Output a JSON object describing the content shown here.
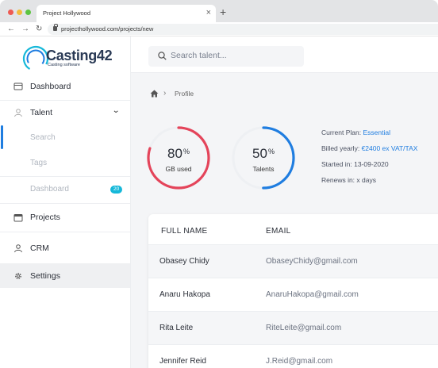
{
  "browser": {
    "tab_title": "Project Hollywood",
    "url": "projecthollywood.com/projects/new"
  },
  "sidebar": {
    "logo_text": "Casting42",
    "logo_sub": "Casting software",
    "items": [
      {
        "label": "Dashboard"
      },
      {
        "label": "Talent"
      },
      {
        "label": "Search"
      },
      {
        "label": "Tags"
      },
      {
        "label": "Dashboard",
        "badge": "20"
      },
      {
        "label": "Projects"
      },
      {
        "label": "CRM"
      },
      {
        "label": "Settings"
      }
    ]
  },
  "search": {
    "placeholder": "Search talent..."
  },
  "breadcrumb": {
    "current": "Profile"
  },
  "gauges": [
    {
      "value": "80",
      "unit": "%",
      "label": "GB used",
      "fraction": 0.8,
      "color": "#e4445a"
    },
    {
      "value": "50",
      "unit": "%",
      "label": "Talents",
      "fraction": 0.5,
      "color": "#1f7de0"
    }
  ],
  "plan": {
    "current_label": "Current Plan:",
    "current_value": "Essential",
    "billed_label": "Billed yearly:",
    "billed_value": "€2400 ex VAT/TAX",
    "started": "Started in: 13-09-2020",
    "renews": "Renews in: x days"
  },
  "table": {
    "headers": [
      "FULL NAME",
      "EMAIL"
    ],
    "rows": [
      {
        "name": "Obasey Chidy",
        "email": "ObaseyChidy@gmail.com"
      },
      {
        "name": "Anaru Hakopa",
        "email": "AnaruHakopa@gmail.com"
      },
      {
        "name": "Rita Leite",
        "email": "RiteLeite@gmail.com"
      },
      {
        "name": "Jennifer Reid",
        "email": "J.Reid@gmail.com"
      }
    ]
  },
  "colors": {
    "accent": "#1f7de0",
    "danger": "#e4445a",
    "badge": "#16b8d9"
  }
}
